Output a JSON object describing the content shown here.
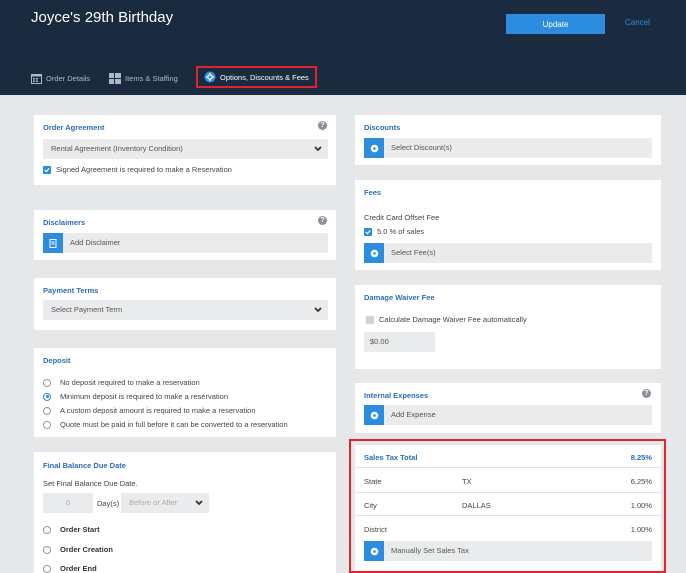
{
  "header": {
    "title": "Joyce's 29th Birthday",
    "update_label": "Update",
    "cancel_label": "Cancel"
  },
  "tabs": [
    {
      "label": "Order Details",
      "icon": "calendar-icon"
    },
    {
      "label": "Items & Staffing",
      "icon": "grid-icon"
    },
    {
      "label": "Options, Discounts & Fees",
      "icon": "gear-icon"
    }
  ],
  "order_agreement": {
    "title": "Order Agreement",
    "selected": "Rental Agreement (Inventory Condition)",
    "checkbox_label": "Signed Agreement is required to make a Reservation"
  },
  "disclaimers": {
    "title": "Disclaimers",
    "add_label": "Add Disclaimer"
  },
  "payment_terms": {
    "title": "Payment Terms",
    "placeholder": "Select Payment Term"
  },
  "deposit": {
    "title": "Deposit",
    "options": [
      "No deposit required to make a reservation",
      "Minimum deposit is required to make a reservation",
      "A custom deposit amount is required to make a reservation",
      "Quote must be paid in full before it can be converted to a reservation"
    ],
    "selected_index": 1
  },
  "final_balance": {
    "title": "Final Balance Due Date",
    "description": "Set Final Balance Due Date.",
    "days_value": "0",
    "days_label": "Day(s)",
    "when_placeholder": "Before or After",
    "options": [
      "Order Start",
      "Order Creation",
      "Order End"
    ]
  },
  "discounts": {
    "title": "Discounts",
    "select_label": "Select Discount(s)"
  },
  "fees": {
    "title": "Fees",
    "fee_name": "Credit Card Offset Fee",
    "fee_detail": "5.0 % of sales",
    "select_label": "Select Fee(s)"
  },
  "damage_waiver": {
    "title": "Damage Waiver Fee",
    "checkbox_label": "Calculate Damage Waiver Fee automatically",
    "amount": "$0.00"
  },
  "internal_expenses": {
    "title": "Internal Expenses",
    "add_label": "Add Expense"
  },
  "sales_tax": {
    "title": "Sales Tax Total",
    "total": "8.25%",
    "rows": [
      {
        "label": "State",
        "value": "TX",
        "rate": "6.25%"
      },
      {
        "label": "City",
        "value": "DALLAS",
        "rate": "1.00%"
      },
      {
        "label": "District",
        "value": "",
        "rate": "1.00%"
      }
    ],
    "manual_label": "Manually Set Sales Tax"
  },
  "colors": {
    "header_bg": "#1b2b3f",
    "accent": "#2c8de0",
    "highlight": "#e3232c"
  }
}
